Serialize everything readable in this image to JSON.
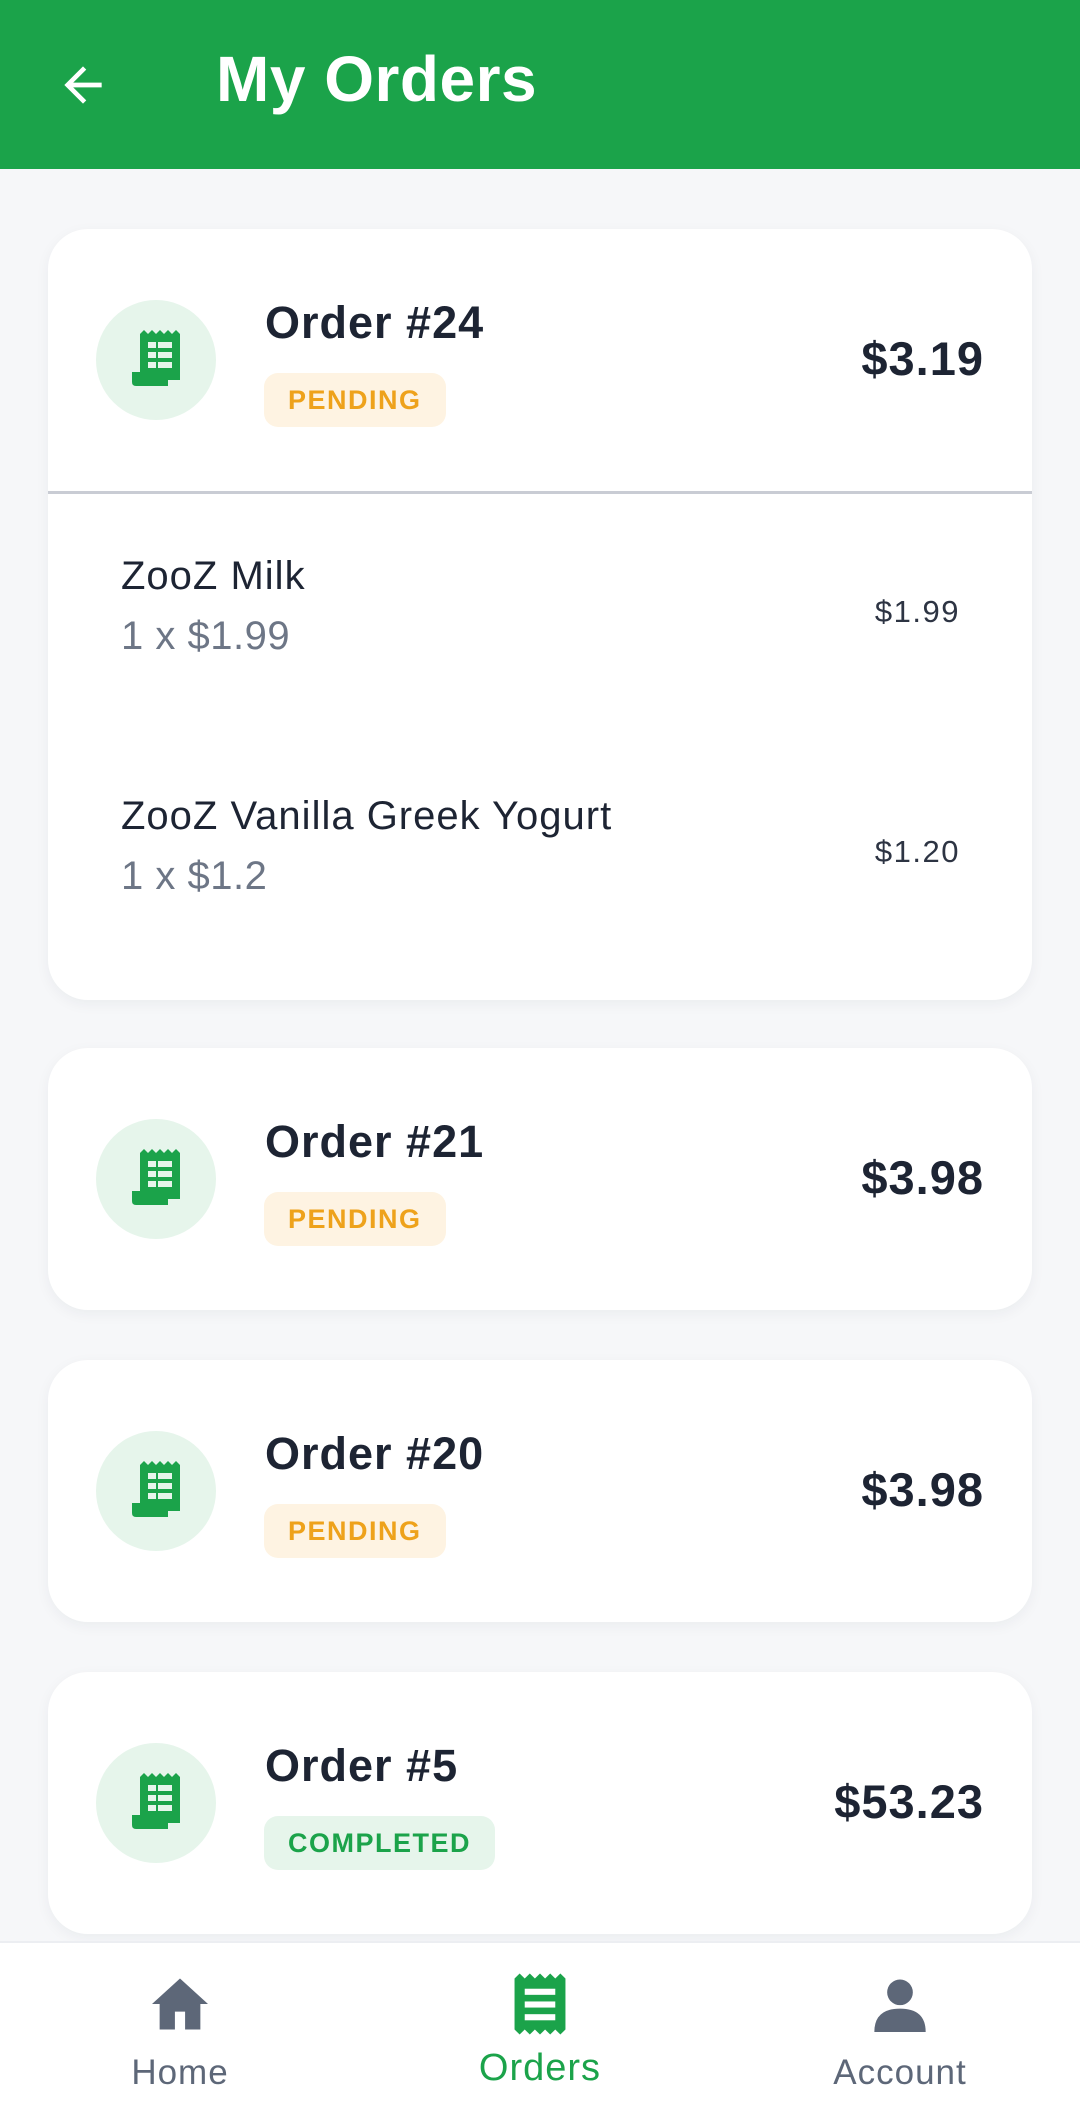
{
  "appbar": {
    "title": "My Orders",
    "back_icon": "arrow-left-icon"
  },
  "orders": [
    {
      "title": "Order #24",
      "status": "PENDING",
      "total": "$3.19",
      "items": [
        {
          "name": "ZooZ Milk",
          "qty": "1 x $1.99",
          "price": "$1.99"
        },
        {
          "name": "ZooZ Vanilla Greek Yogurt",
          "qty": "1 x $1.2",
          "price": "$1.20"
        }
      ]
    },
    {
      "title": "Order #21",
      "status": "PENDING",
      "total": "$3.98"
    },
    {
      "title": "Order #20",
      "status": "PENDING",
      "total": "$3.98"
    },
    {
      "title": "Order #5",
      "status": "COMPLETED",
      "total": "$53.23"
    }
  ],
  "bottom_nav": {
    "home": "Home",
    "orders": "Orders",
    "account": "Account"
  },
  "colors": {
    "brand": "#1ba34a",
    "pending_text": "#eea21b",
    "pending_bg": "#fef3e2",
    "completed_bg": "#e6f5eb",
    "nav_inactive": "#5d6778"
  }
}
